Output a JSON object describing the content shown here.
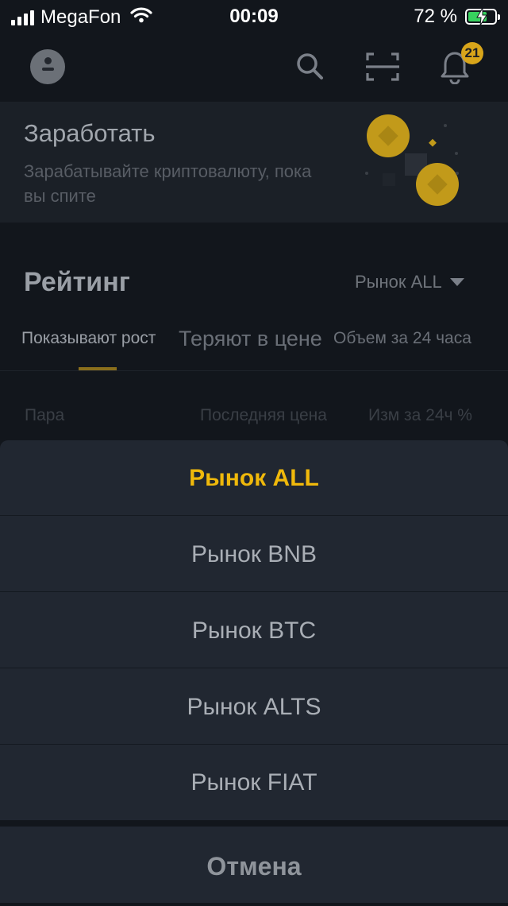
{
  "status_bar": {
    "carrier": "MegaFon",
    "time": "00:09",
    "battery_text": "72 %",
    "battery_level": 0.72
  },
  "header": {
    "notification_count": "21",
    "icons": [
      "avatar",
      "search-icon",
      "scan-icon",
      "bell-icon"
    ]
  },
  "earn": {
    "title": "Заработать",
    "subtitle": "Зарабатывайте криптовалюту, пока вы спите"
  },
  "rating": {
    "title": "Рейтинг",
    "market_label": "Рынок ALL",
    "tabs": [
      "Показывают рост",
      "Теряют в цене",
      "Объем за 24 часа"
    ],
    "columns": [
      "Пара",
      "Последняя цена",
      "Изм за 24ч %"
    ]
  },
  "sheet": {
    "options": [
      "Рынок ALL",
      "Рынок BNB",
      "Рынок BTC",
      "Рынок ALTS",
      "Рынок FIAT"
    ],
    "selected_index": 0,
    "cancel_label": "Отмена"
  },
  "colors": {
    "accent": "#F0B90B",
    "background": "#12161C",
    "sheet": "#212731"
  }
}
